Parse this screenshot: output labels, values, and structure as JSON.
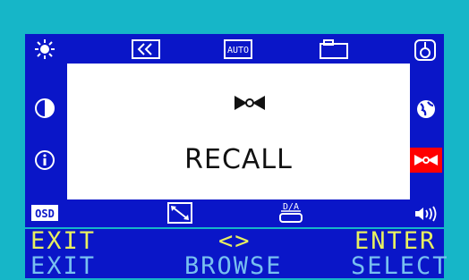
{
  "colors": {
    "background": "#16b6c8",
    "panel": "#0a16c8",
    "hint_top": "#e8f060",
    "hint_bottom": "#78c0f0",
    "selected": "#ff0000"
  },
  "menu": {
    "icons": [
      {
        "name": "brightness-icon"
      },
      {
        "name": "position-back-icon"
      },
      {
        "name": "auto-icon",
        "label": "AUTO"
      },
      {
        "name": "size-icon"
      },
      {
        "name": "language-icon"
      },
      {
        "name": "contrast-icon"
      },
      {
        "name": "color-globe-icon"
      },
      {
        "name": "info-icon"
      },
      {
        "name": "recall-icon",
        "selected": true
      },
      {
        "name": "osd-icon",
        "label": "OSD"
      },
      {
        "name": "diagonal-resize-icon"
      },
      {
        "name": "da-icon",
        "label": "D/A"
      },
      {
        "name": "volume-icon"
      }
    ]
  },
  "center": {
    "title": "RECALL"
  },
  "hints_top": {
    "left": "EXIT",
    "middle": "<>",
    "right": "ENTER"
  },
  "hints_bottom": {
    "left": "EXIT",
    "middle": "BROWSE",
    "right": "SELECT"
  }
}
